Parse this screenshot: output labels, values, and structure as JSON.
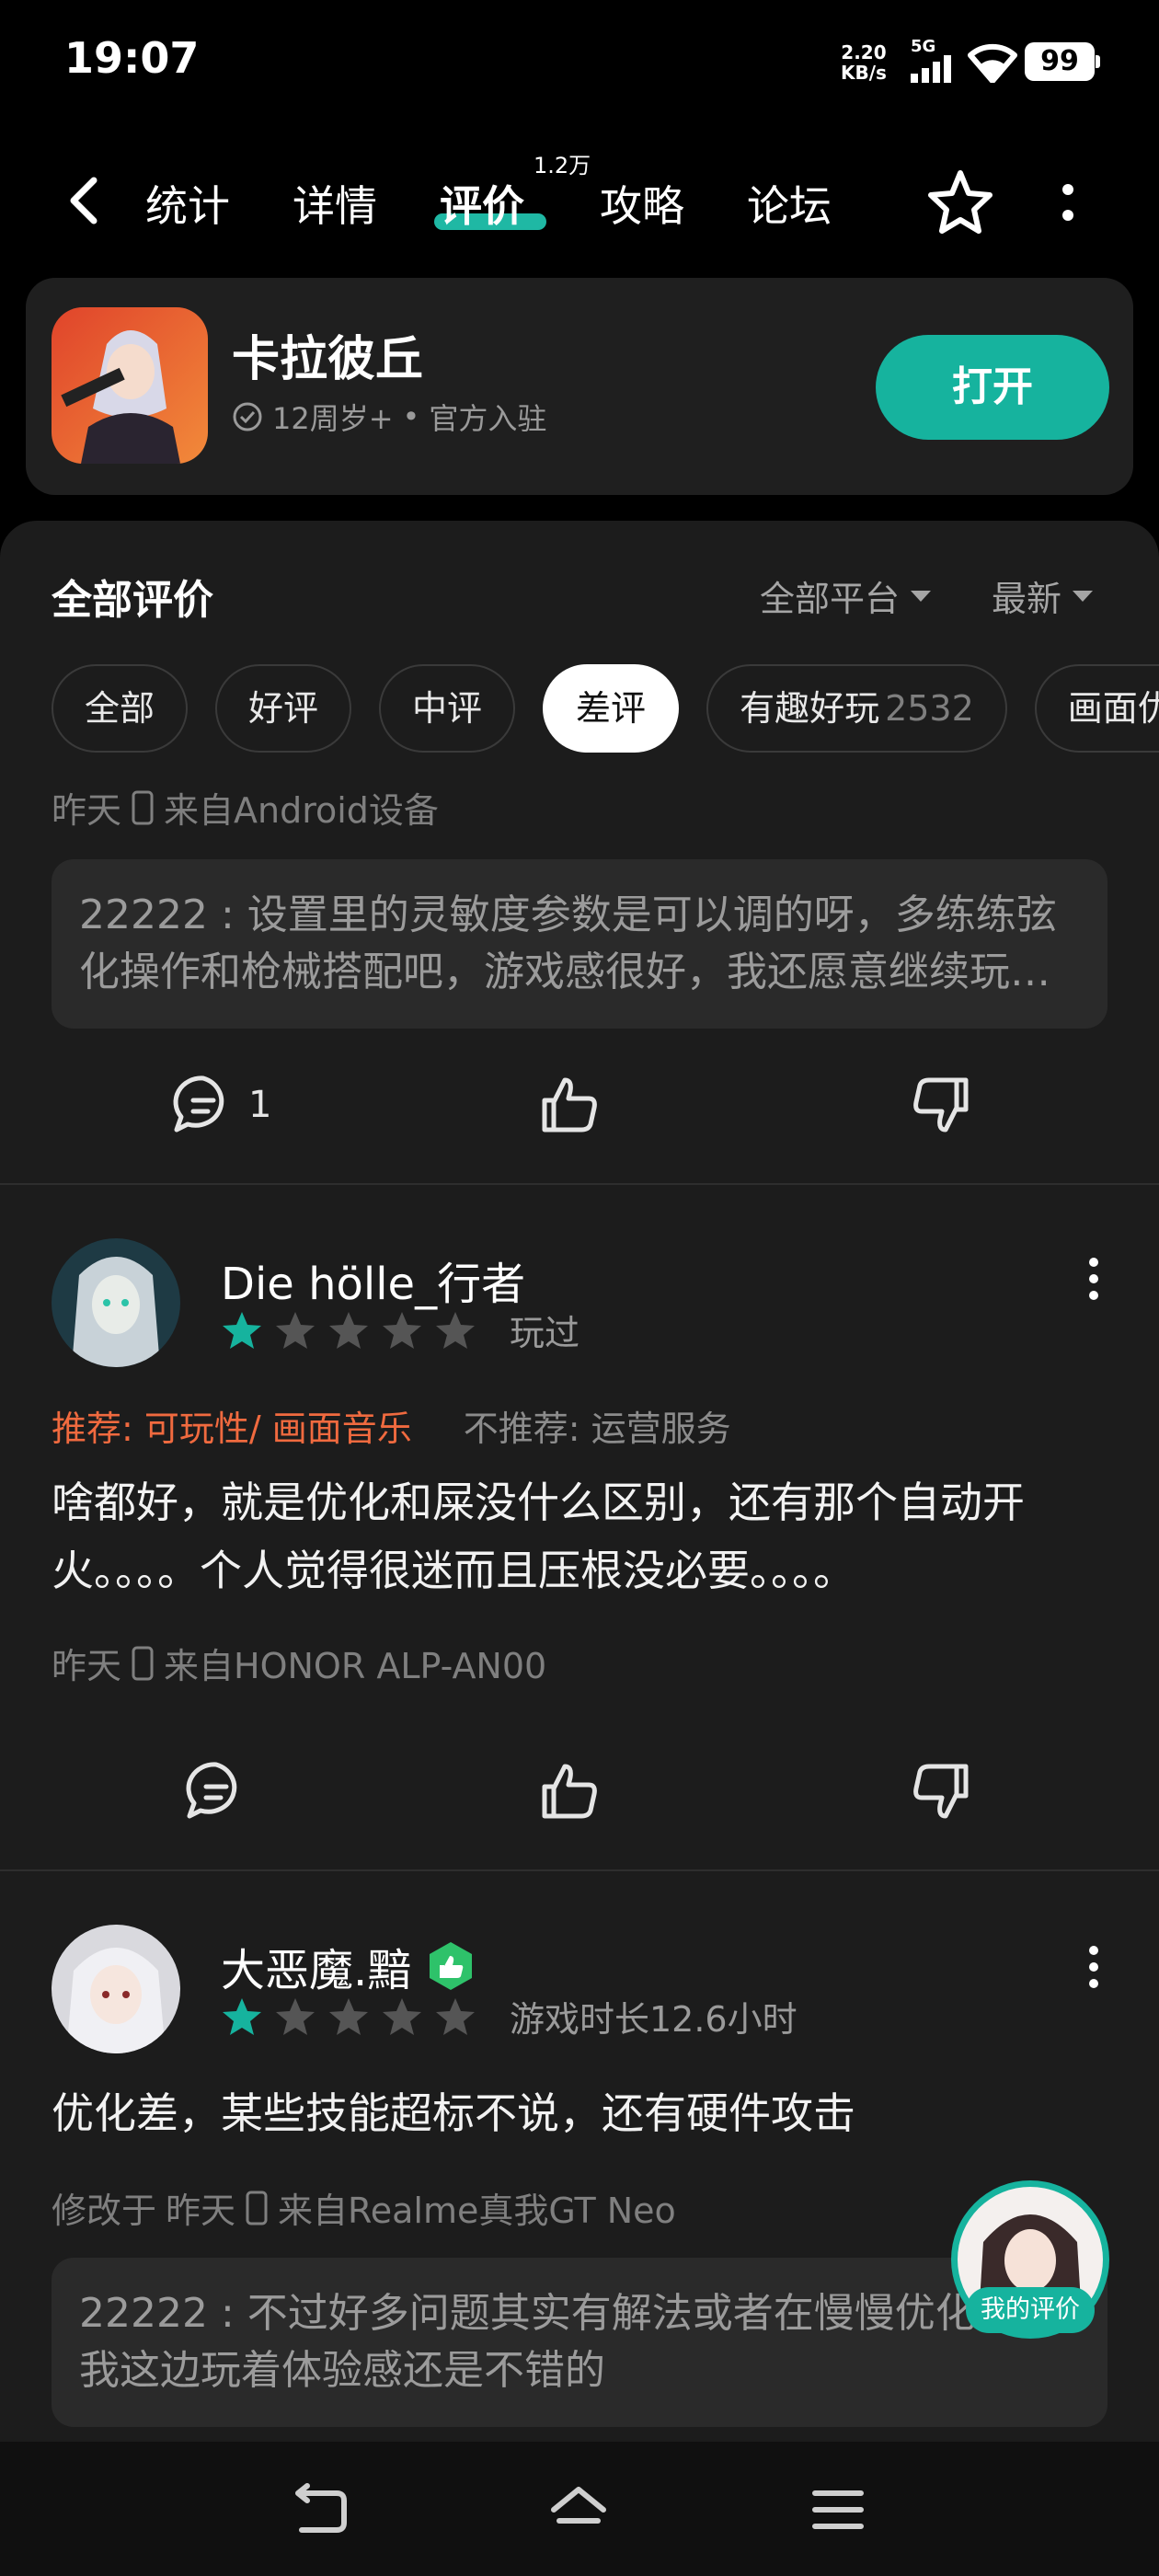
{
  "status_bar": {
    "time": "19:07",
    "speed_value": "2.20",
    "speed_unit": "KB/s",
    "network": "5G",
    "battery": "99"
  },
  "nav": {
    "tabs": [
      {
        "label": "统计"
      },
      {
        "label": "详情"
      },
      {
        "label": "评价"
      },
      {
        "label": "攻略"
      },
      {
        "label": "论坛"
      }
    ],
    "active_tab": "评价",
    "review_count_badge": "1.2万"
  },
  "app": {
    "name": "卡拉彼丘",
    "age_rating": "12周岁+",
    "separator": "•",
    "official": "官方入驻",
    "open_label": "打开"
  },
  "reviews_header": {
    "title": "全部评价",
    "platform_filter": "全部平台",
    "sort": "最新"
  },
  "chips": [
    {
      "label": "全部",
      "count": ""
    },
    {
      "label": "好评",
      "count": ""
    },
    {
      "label": "中评",
      "count": ""
    },
    {
      "label": "差评",
      "count": ""
    },
    {
      "label": "有趣好玩",
      "count": "2532"
    },
    {
      "label": "画面优",
      "count": ""
    }
  ],
  "selected_chip": "差评",
  "review0": {
    "date": "昨天",
    "device": "来自Android设备",
    "reply_author": "22222",
    "reply_sep": " : ",
    "reply_text": "设置里的灵敏度参数是可以调的呀，多练练弦化操作和枪械搭配吧，游戏感很好，我还愿意继续玩下去的",
    "comment_count": "1"
  },
  "review1": {
    "user": "Die hölle_行者",
    "rating": 1,
    "play_info": "玩过",
    "recommend": "推荐: 可玩性/ 画面音乐",
    "not_recommend": "不推荐: 运营服务",
    "text": "啥都好，就是优化和屎没什么区别，还有那个自动开火。。。。个人觉得很迷而且压根没必要。。。。",
    "date": "昨天",
    "device": "来自HONOR ALP-AN00"
  },
  "review2": {
    "user": "大恶魔.黯",
    "rating": 1,
    "play_info": "游戏时长12.6小时",
    "text": "优化差，某些技能超标不说，还有硬件攻击",
    "modified_prefix": "修改于",
    "date": "昨天",
    "device": "来自Realme真我GT Neo",
    "reply_author": "22222",
    "reply_sep": " : ",
    "reply_text": "不过好多问题其实有解法或者在慢慢优化了，我这边玩着体验感还是不错的"
  },
  "floating": {
    "my_review_label": "我的评价"
  },
  "colors": {
    "accent": "#16b39e",
    "recommend": "#f06a3f",
    "background": "#000000",
    "panel": "#1c1c1c"
  }
}
